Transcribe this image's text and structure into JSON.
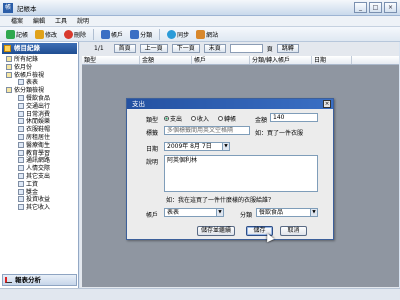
{
  "window": {
    "app_icon": "帳",
    "title": "記帳本",
    "controls": [
      "_",
      "□",
      "×"
    ]
  },
  "menu": [
    "檔案",
    "編輯",
    "工具",
    "說明"
  ],
  "toolbar": [
    {
      "label": "記帳",
      "icon": "add-icon",
      "color": "#2fa84f"
    },
    {
      "label": "修改",
      "icon": "edit-icon",
      "color": "#e0a21a"
    },
    {
      "label": "刪除",
      "icon": "delete-icon",
      "color": "#d83a2e"
    },
    {
      "label": "帳戶",
      "icon": "account-icon",
      "color": "#3a6fc4"
    },
    {
      "label": "分類",
      "icon": "category-icon",
      "color": "#3a6fc4"
    },
    {
      "label": "同步",
      "icon": "sync-icon",
      "color": "#2b9bd8"
    },
    {
      "label": "網站",
      "icon": "home-icon",
      "color": "#d8872b"
    }
  ],
  "sidebar": {
    "header": "帳目紀錄",
    "tree": [
      {
        "label": "所有紀錄",
        "level": 1
      },
      {
        "label": "依月份",
        "level": 1
      },
      {
        "label": "依帳戶檢視",
        "level": 1
      },
      {
        "label": "表表",
        "level": 2
      },
      {
        "label": "依分類檢視",
        "level": 1
      },
      {
        "label": "餐飲食品",
        "level": 2
      },
      {
        "label": "交通出行",
        "level": 2
      },
      {
        "label": "日常消費",
        "level": 2
      },
      {
        "label": "休閒娛樂",
        "level": 2
      },
      {
        "label": "衣服鞋帽",
        "level": 2
      },
      {
        "label": "房租居住",
        "level": 2
      },
      {
        "label": "醫療衛生",
        "level": 2
      },
      {
        "label": "教育學習",
        "level": 2
      },
      {
        "label": "通訊網路",
        "level": 2
      },
      {
        "label": "人情交際",
        "level": 2
      },
      {
        "label": "其它支出",
        "level": 2
      },
      {
        "label": "工資",
        "level": 2
      },
      {
        "label": "獎金",
        "level": 2
      },
      {
        "label": "投資收益",
        "level": 2
      },
      {
        "label": "其它收入",
        "level": 2
      }
    ],
    "footer": "報表分析"
  },
  "nav": {
    "page_label": "1/1",
    "first": "首頁",
    "prev": "上一頁",
    "next": "下一頁",
    "last": "末頁",
    "page_value": "頁",
    "jump": "跳轉"
  },
  "grid": {
    "columns": [
      "類型",
      "金額",
      "帳戶",
      "分類/轉入帳戶",
      "日期"
    ]
  },
  "dialog": {
    "title": "支出",
    "type_label": "類型",
    "types": [
      "支出",
      "收入",
      "轉帳"
    ],
    "selected_type": "支出",
    "amount_label": "金額",
    "amount_value": "140",
    "tags_label": "標籤",
    "tags_value": "多個標籤間用英文空格隔",
    "tags_hint": "如：買了一件衣服",
    "date_label": "日期",
    "date_value": "2009年  8月  7日",
    "desc_label": "說明",
    "desc_value": "阿英個利林",
    "desc_hint": "如：我在這買了一件什麼樣的衣服給誰？",
    "account_label": "帳戶",
    "account_value": "表表",
    "category_label": "分類",
    "category_value": "餐飲食品",
    "save_continue": "儲存並繼續",
    "save": "儲存",
    "cancel": "取消"
  }
}
